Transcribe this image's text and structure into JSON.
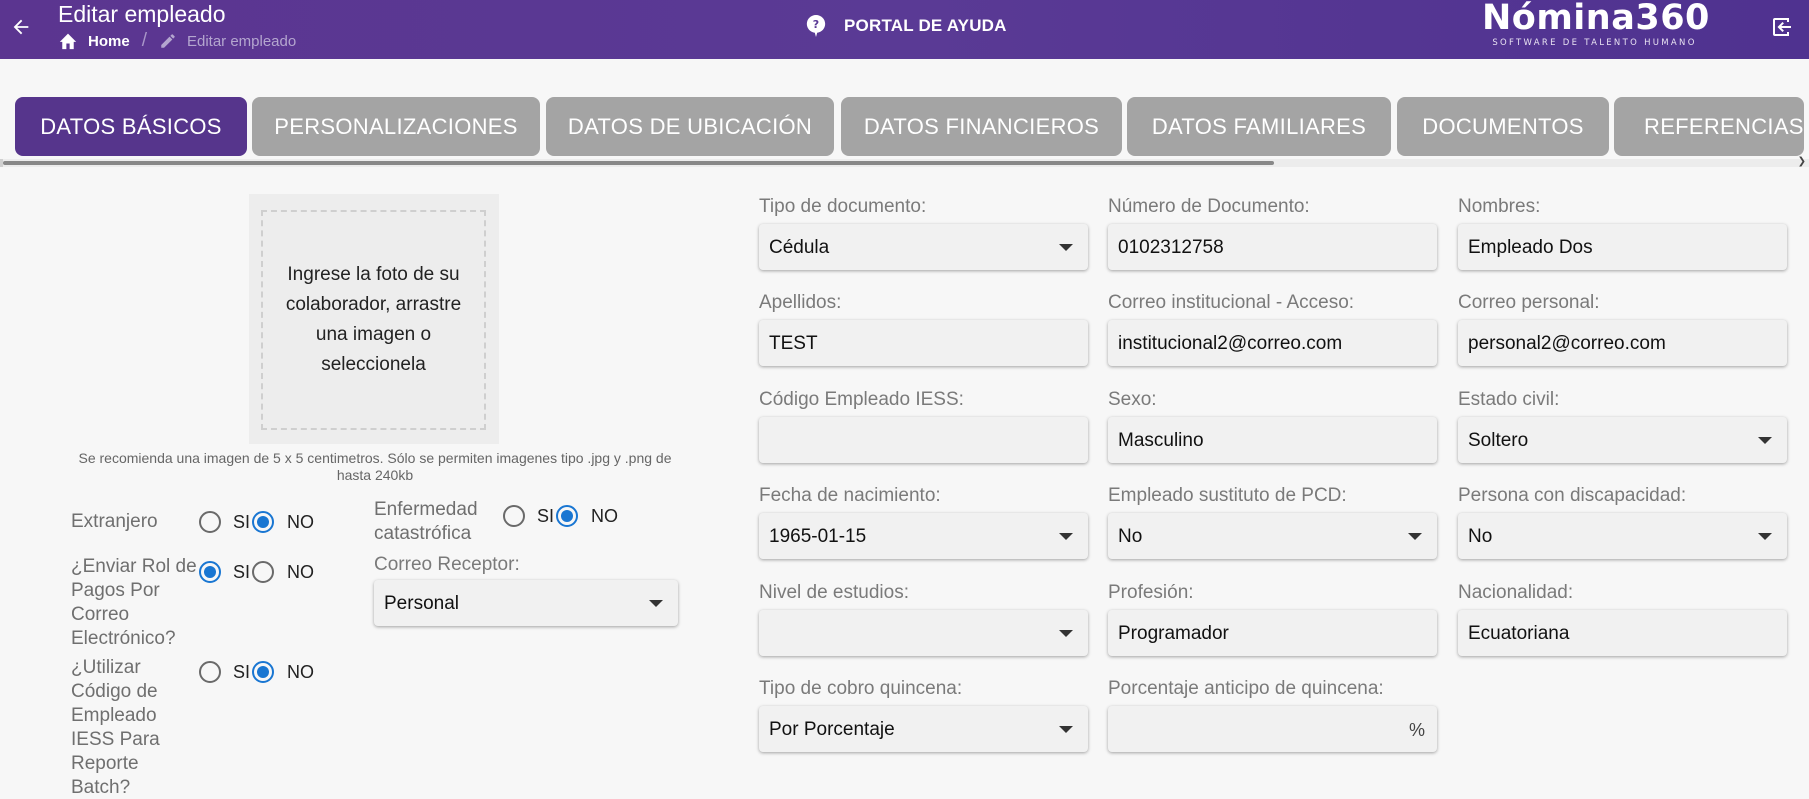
{
  "header": {
    "title": "Editar empleado",
    "breadcrumb_home": "Home",
    "breadcrumb_separator": "/",
    "breadcrumb_current": "Editar empleado",
    "help_label": "PORTAL DE AYUDA",
    "logo_text": "Nómina360",
    "logo_subtitle": "SOFTWARE DE TALENTO HUMANO",
    "bg_color": "#5a3a95"
  },
  "tabs": [
    {
      "label": "DATOS BÁSICOS",
      "active": true
    },
    {
      "label": "PERSONALIZACIONES",
      "active": false
    },
    {
      "label": "DATOS DE UBICACIÓN",
      "active": false
    },
    {
      "label": "DATOS FINANCIEROS",
      "active": false
    },
    {
      "label": "DATOS FAMILIARES",
      "active": false
    },
    {
      "label": "DOCUMENTOS",
      "active": false
    },
    {
      "label": "REFERENCIAS",
      "active": false
    }
  ],
  "photo": {
    "prompt": "Ingrese la foto de su colaborador, arrastre una imagen o seleccionela",
    "note": "Se recomienda una imagen de 5 x 5 centimetros. Sólo se permiten imagenes tipo .jpg y .png de hasta 240kb"
  },
  "options": {
    "si": "SI",
    "no": "NO"
  },
  "radio_groups": {
    "extranjero": {
      "label": "Extranjero",
      "selected": "NO"
    },
    "enviar_rol": {
      "label": "¿Enviar Rol de Pagos Por Correo Electrónico?",
      "selected": "SI"
    },
    "utilizar_codigo": {
      "label": "¿Utilizar Código de Empleado IESS Para Reporte Batch?",
      "selected": "NO"
    },
    "enfermedad": {
      "label": "Enfermedad catastrófica",
      "selected": "NO"
    }
  },
  "correo_receptor": {
    "label": "Correo Receptor:",
    "value": "Personal"
  },
  "fields": {
    "tipo_documento": {
      "label": "Tipo de documento:",
      "value": "Cédula"
    },
    "numero_documento": {
      "label": "Número de Documento:",
      "value": "0102312758"
    },
    "nombres": {
      "label": "Nombres:",
      "value": "Empleado Dos"
    },
    "apellidos": {
      "label": "Apellidos:",
      "value": "TEST"
    },
    "correo_institucional": {
      "label": "Correo institucional - Acceso:",
      "value": "institucional2@correo.com"
    },
    "correo_personal": {
      "label": "Correo personal:",
      "value": "personal2@correo.com"
    },
    "codigo_iess": {
      "label": "Código Empleado IESS:",
      "value": ""
    },
    "sexo": {
      "label": "Sexo:",
      "value": "Masculino"
    },
    "estado_civil": {
      "label": "Estado civil:",
      "value": "Soltero"
    },
    "fecha_nacimiento": {
      "label": "Fecha de nacimiento:",
      "value": "1965-01-15"
    },
    "sustituto_pcd": {
      "label": "Empleado sustituto de PCD:",
      "value": "No"
    },
    "discapacidad": {
      "label": "Persona con discapacidad:",
      "value": "No"
    },
    "nivel_estudios": {
      "label": "Nivel de estudios:",
      "value": ""
    },
    "profesion": {
      "label": "Profesión:",
      "value": "Programador"
    },
    "nacionalidad": {
      "label": "Nacionalidad:",
      "value": "Ecuatoriana"
    },
    "tipo_cobro": {
      "label": "Tipo de cobro quincena:",
      "value": "Por Porcentaje"
    },
    "porcentaje_anticipo": {
      "label": "Porcentaje anticipo de quincena:",
      "value": "",
      "suffix": "%"
    }
  }
}
